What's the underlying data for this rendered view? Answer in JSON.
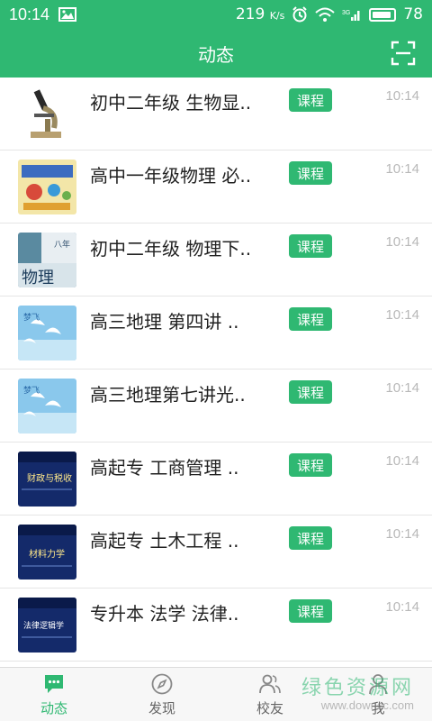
{
  "status_bar": {
    "time": "10:14",
    "network_speed": "219",
    "network_unit": "K/s",
    "battery": "78"
  },
  "app_bar": {
    "title": "动态",
    "scan_icon": "scan-icon"
  },
  "feed": [
    {
      "title": "初中二年级 生物显..",
      "tag": "课程",
      "time": "10:14",
      "thumb": "microscope"
    },
    {
      "title": "高中一年级物理 必..",
      "tag": "课程",
      "time": "10:14",
      "thumb": "physics-poster"
    },
    {
      "title": "初中二年级 物理下..",
      "tag": "课程",
      "time": "10:14",
      "thumb": "physics-book"
    },
    {
      "title": "高三地理  第四讲  ..",
      "tag": "课程",
      "time": "10:14",
      "thumb": "doves-sky"
    },
    {
      "title": "高三地理第七讲光..",
      "tag": "课程",
      "time": "10:14",
      "thumb": "doves-sky"
    },
    {
      "title": "高起专  工商管理  ..",
      "tag": "课程",
      "time": "10:14",
      "thumb": "lecture-slide",
      "slide_text": "财政与税收"
    },
    {
      "title": "高起专  土木工程  ..",
      "tag": "课程",
      "time": "10:14",
      "thumb": "lecture-slide",
      "slide_text": "材料力学"
    },
    {
      "title": "专升本  法学  法律..",
      "tag": "课程",
      "time": "10:14",
      "thumb": "lecture-slide",
      "slide_text": "法律逻辑学"
    }
  ],
  "tab_bar": [
    {
      "label": "动态",
      "icon": "chat-bubble-icon",
      "active": true
    },
    {
      "label": "发现",
      "icon": "compass-icon",
      "active": false
    },
    {
      "label": "校友",
      "icon": "people-icon",
      "active": false
    },
    {
      "label": "我",
      "icon": "person-icon",
      "active": false
    }
  ],
  "watermark": {
    "main": "绿色资源网",
    "sub": "www.downcc.com"
  },
  "colors": {
    "brand": "#2fb872",
    "time_text": "#b8b8b8",
    "title_text": "#222222"
  }
}
